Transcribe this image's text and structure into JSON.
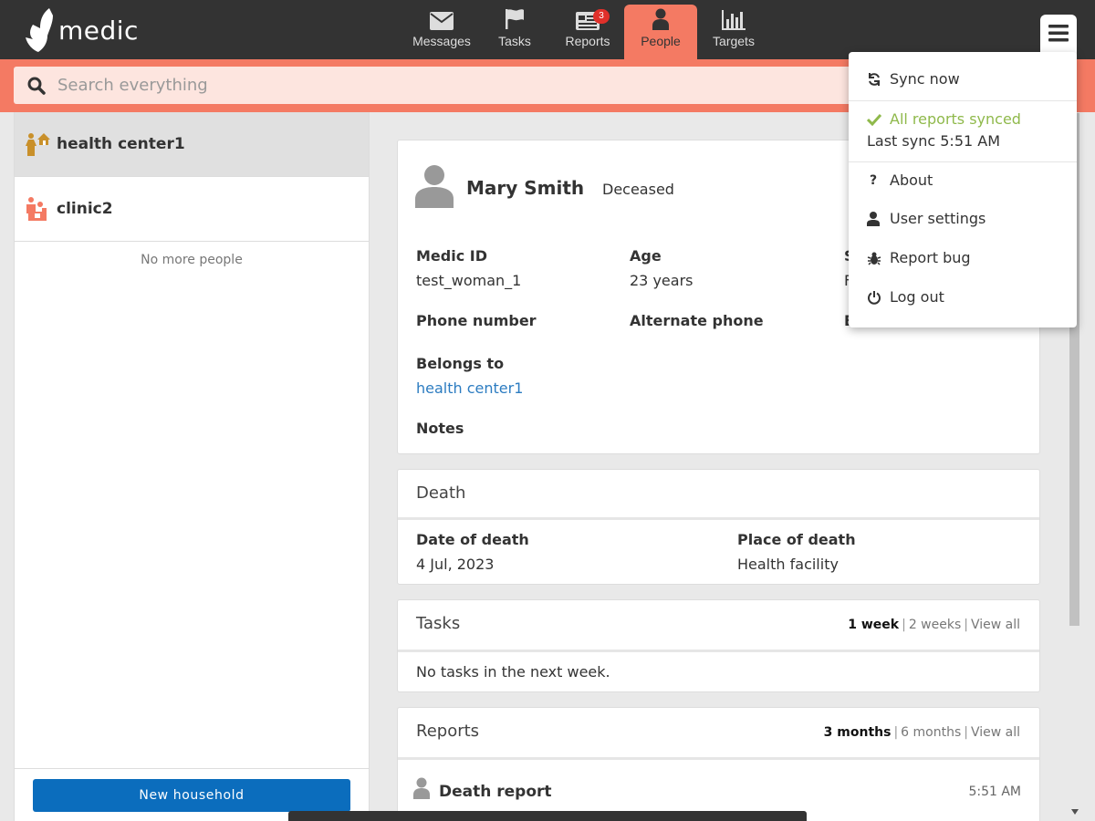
{
  "header": {
    "logo_text": "medic",
    "tabs": [
      {
        "label": "Messages",
        "icon": "envelope-icon"
      },
      {
        "label": "Tasks",
        "icon": "flag-icon"
      },
      {
        "label": "Reports",
        "icon": "reports-icon",
        "badge": "3"
      },
      {
        "label": "People",
        "icon": "person-icon",
        "active": true
      },
      {
        "label": "Targets",
        "icon": "bar-chart-icon"
      }
    ],
    "accent_color": "#f47a63"
  },
  "search": {
    "placeholder": "Search everything"
  },
  "people_list": {
    "items": [
      {
        "name": "health center1",
        "icon": "health-center-icon",
        "selected": true
      },
      {
        "name": "clinic2",
        "icon": "clinic-icon",
        "selected": false
      }
    ],
    "end_text": "No more people",
    "new_button": "New household"
  },
  "contact": {
    "name": "Mary Smith",
    "status": "Deceased",
    "medic_id_label": "Medic ID",
    "medic_id": "test_woman_1",
    "age_label": "Age",
    "age": "23 years",
    "col3_label_partial": "S",
    "col3_value_partial": "F",
    "phone_label": "Phone number",
    "alt_phone_label": "Alternate phone",
    "col3_row2_partial": "E",
    "belongs_label": "Belongs to",
    "belongs_to": "health center1",
    "notes_label": "Notes"
  },
  "death": {
    "title": "Death",
    "date_label": "Date of death",
    "date": "4 Jul, 2023",
    "place_label": "Place of death",
    "place": "Health facility"
  },
  "tasks": {
    "title": "Tasks",
    "range": [
      "1 week",
      "2 weeks",
      "View all"
    ],
    "empty": "No tasks in the next week."
  },
  "reports": {
    "title": "Reports",
    "range": [
      "3 months",
      "6 months",
      "View all"
    ],
    "item_name": "Death report",
    "item_time": "5:51 AM"
  },
  "menu": {
    "sync_now": "Sync now",
    "synced": "All reports synced",
    "last_sync": "Last sync 5:51 AM",
    "about": "About",
    "user_settings": "User settings",
    "report_bug": "Report bug",
    "log_out": "Log out"
  }
}
